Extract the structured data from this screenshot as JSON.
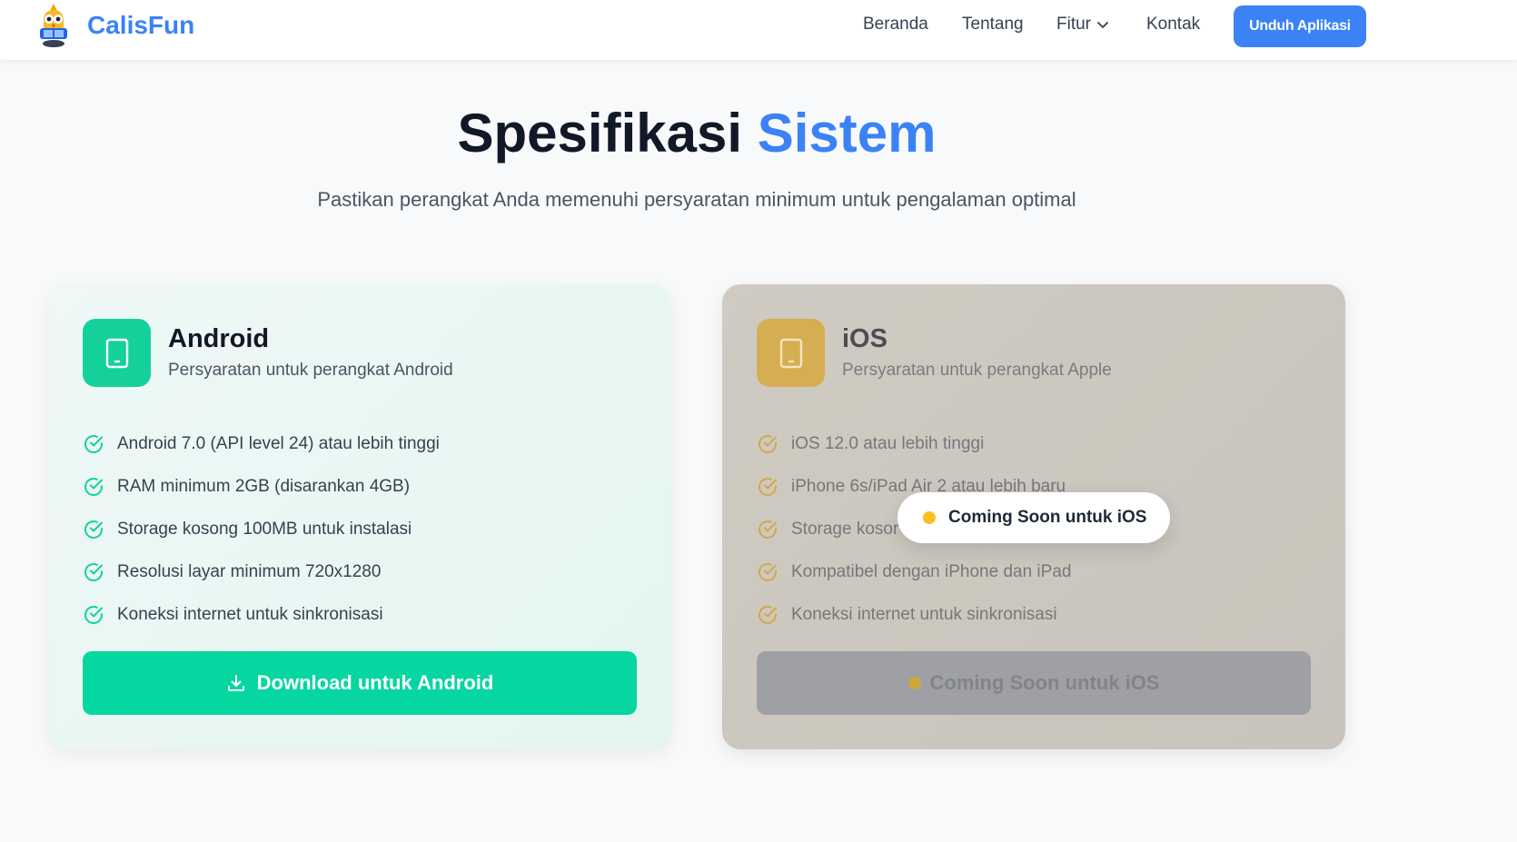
{
  "header": {
    "brand": "CalisFun",
    "nav": [
      {
        "label": "Beranda"
      },
      {
        "label": "Tentang"
      },
      {
        "label": "Fitur"
      },
      {
        "label": "Kontak"
      }
    ],
    "cta_label": "Unduh Aplikasi"
  },
  "section": {
    "title_main": "Spesifikasi",
    "title_accent": "Sistem",
    "subtitle": "Pastikan perangkat Anda memenuhi persyaratan minimum untuk pengalaman optimal"
  },
  "android": {
    "name": "Android",
    "description": "Persyaratan untuk perangkat Android",
    "requirements": [
      "Android 7.0 (API level 24) atau lebih tinggi",
      "RAM minimum 2GB (disarankan 4GB)",
      "Storage kosong 100MB untuk instalasi",
      "Resolusi layar minimum 720x1280",
      "Koneksi internet untuk sinkronisasi"
    ],
    "button_label": "Download untuk Android"
  },
  "ios": {
    "name": "iOS",
    "description": "Persyaratan untuk perangkat Apple",
    "requirements": [
      "iOS 12.0 atau lebih tinggi",
      "iPhone 6s/iPad Air 2 atau lebih baru",
      "Storage kosor",
      "Kompatibel dengan iPhone dan iPad",
      "Koneksi internet untuk sinkronisasi"
    ],
    "button_label": "Coming Soon untuk iOS",
    "overlay_label": "Coming Soon untuk iOS"
  },
  "colors": {
    "brand_blue": "#3b82f6",
    "android_green": "#06d6a0",
    "ios_gold": "#d6ae52",
    "soon_dot": "#fbbf24"
  },
  "icons": [
    "calisfun-mascot-logo",
    "chevron-down-icon",
    "tablet-icon",
    "check-circle-icon",
    "download-icon",
    "status-dot-icon"
  ]
}
